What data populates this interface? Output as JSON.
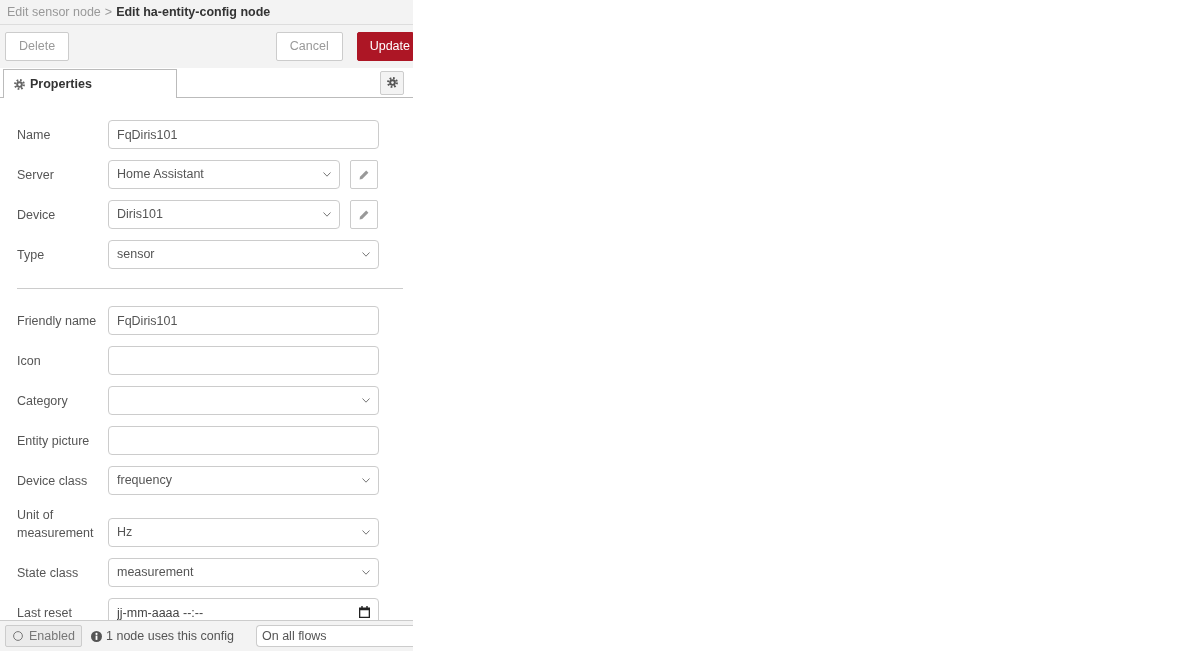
{
  "breadcrumb": {
    "items": [
      {
        "label": "Edit sensor node",
        "current": false
      },
      {
        "label": "Edit ha-entity-config node",
        "current": true
      }
    ],
    "separator": ">"
  },
  "toolbar": {
    "left_buttons": [
      {
        "label": "Delete",
        "kind": "default"
      }
    ],
    "right_buttons": [
      {
        "label": "Cancel",
        "kind": "default"
      },
      {
        "label": "Update",
        "kind": "primary"
      }
    ]
  },
  "tabs": [
    {
      "label": "Properties",
      "selected": true
    }
  ],
  "sections": [
    {
      "fields": [
        {
          "label": "Name",
          "kind": "text",
          "value": "FqDiris101"
        },
        {
          "label": "Server",
          "kind": "select",
          "value": "Home Assistant",
          "edit_button": true
        },
        {
          "label": "Device",
          "kind": "select",
          "value": "Diris101",
          "edit_button": true
        },
        {
          "label": "Type",
          "kind": "select",
          "value": "sensor"
        }
      ]
    },
    {
      "fields": [
        {
          "label": "Friendly name",
          "kind": "text",
          "value": "FqDiris101"
        },
        {
          "label": "Icon",
          "kind": "text"
        },
        {
          "label": "Category",
          "kind": "select"
        },
        {
          "label": "Entity picture",
          "kind": "text"
        },
        {
          "label": "Device class",
          "kind": "select",
          "value": "frequency"
        },
        {
          "label": "Unit of measurement",
          "kind": "select",
          "value": "Hz"
        },
        {
          "label": "State class",
          "kind": "select",
          "value": "measurement"
        },
        {
          "label": "Last reset",
          "kind": "datetime",
          "placeholder": "jj-mm-aaaa --:--"
        }
      ]
    }
  ],
  "footer": {
    "toggle": {
      "label": "Enabled",
      "enabled": true
    },
    "info": "1 node uses this config",
    "scope": {
      "value": "On all flows"
    }
  }
}
